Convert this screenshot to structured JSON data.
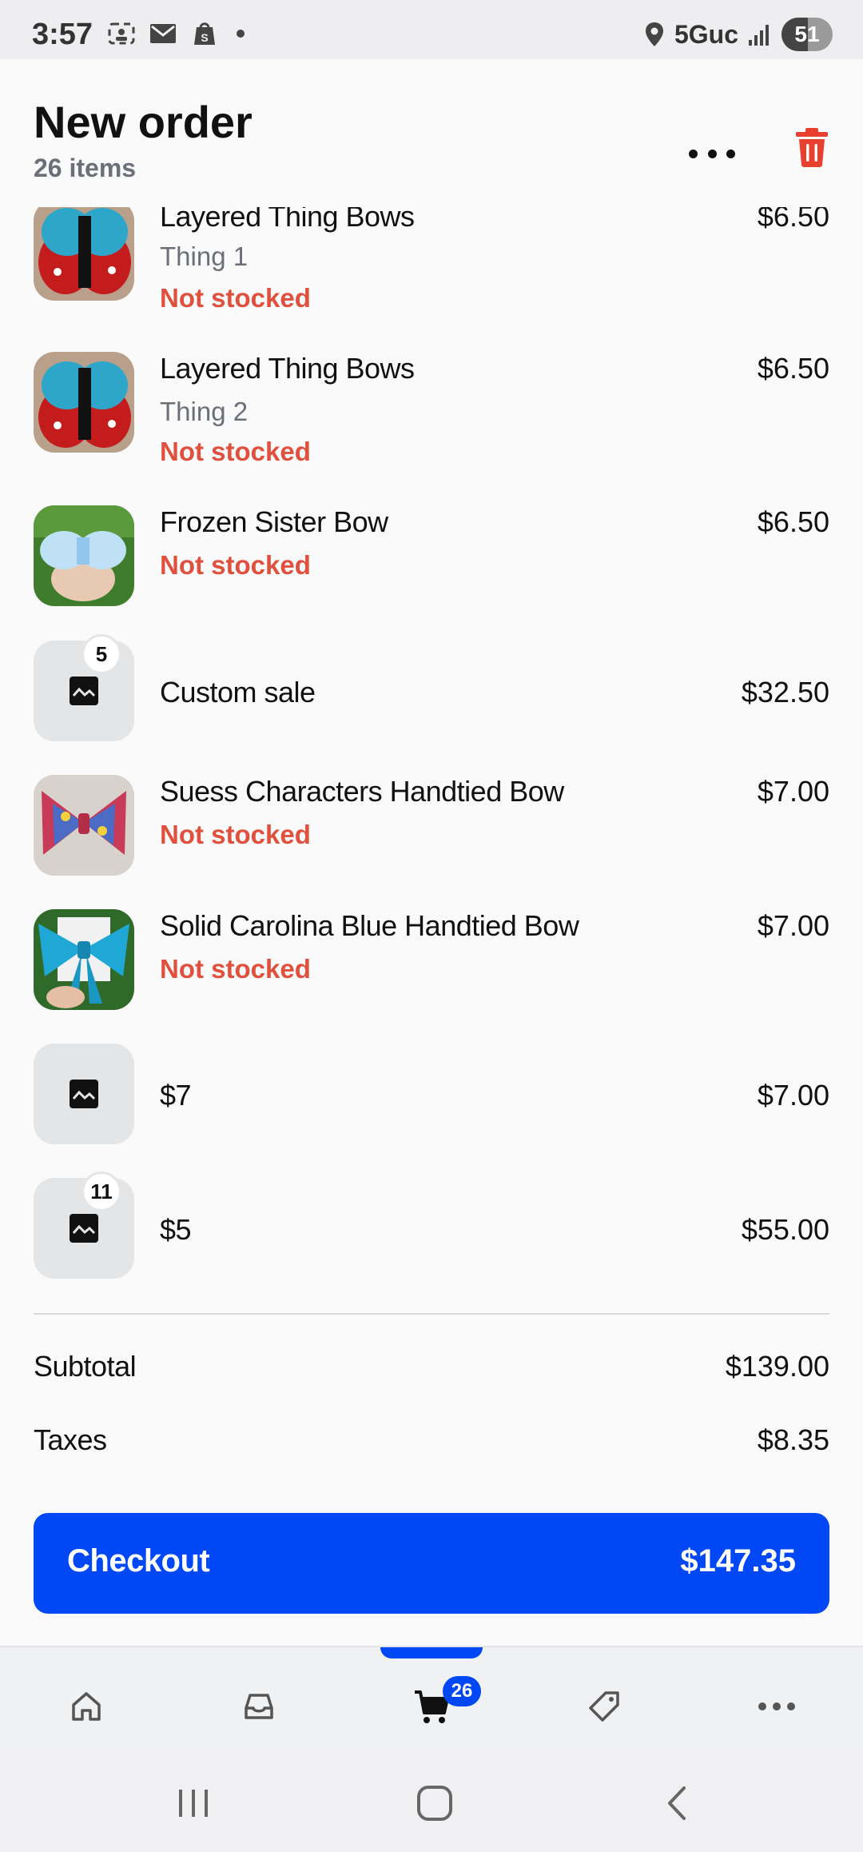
{
  "status_bar": {
    "time": "3:57",
    "network": "5Guc",
    "battery_level": "51",
    "battery_fraction": 0.51,
    "left_icons": [
      "screenshot-icon",
      "mail-icon",
      "shopify-icon",
      "notification-dot"
    ],
    "right_icons": [
      "location-icon",
      "signal-icon",
      "battery-icon"
    ]
  },
  "header": {
    "title": "New order",
    "subtitle": "26 items",
    "more_icon": "more-horizontal-icon",
    "delete_icon": "trash-icon"
  },
  "items": [
    {
      "name": "Layered Thing Bows",
      "variant": "Thing 1",
      "stock": "Not stocked",
      "price": "$6.50",
      "thumb": "bows-photo"
    },
    {
      "name": "Layered Thing Bows",
      "variant": "Thing 2",
      "stock": "Not stocked",
      "price": "$6.50",
      "thumb": "bows-photo"
    },
    {
      "name": "Frozen Sister Bow",
      "stock": "Not stocked",
      "price": "$6.50",
      "thumb": "frozen-bow-photo"
    },
    {
      "name": "Custom sale",
      "price": "$32.50",
      "quantity": "5",
      "thumb": "image-placeholder-icon"
    },
    {
      "name": "Suess Characters Handtied Bow",
      "stock": "Not stocked",
      "price": "$7.00",
      "thumb": "suess-bow-photo"
    },
    {
      "name": "Solid Carolina Blue Handtied Bow",
      "stock": "Not stocked",
      "price": "$7.00",
      "thumb": "blue-bow-photo"
    },
    {
      "name": "$7",
      "price": "$7.00",
      "thumb": "image-placeholder-icon"
    },
    {
      "name": "$5",
      "price": "$55.00",
      "quantity": "11",
      "thumb": "image-placeholder-icon"
    }
  ],
  "summary": {
    "subtotal_label": "Subtotal",
    "subtotal_value": "$139.00",
    "taxes_label": "Taxes",
    "taxes_value": "$8.35"
  },
  "checkout": {
    "label": "Checkout",
    "total": "$147.35"
  },
  "bottom_nav": {
    "items": [
      "home-icon",
      "orders-icon",
      "cart-icon",
      "tag-icon",
      "more-icon"
    ],
    "active": "cart-icon",
    "cart_badge": "26"
  },
  "system_nav": {
    "items": [
      "recents-button",
      "home-button",
      "back-button"
    ]
  },
  "colors": {
    "accent": "#0047f5",
    "warning": "#e0503c",
    "muted": "#6b6f78",
    "delete": "#e8402e"
  }
}
